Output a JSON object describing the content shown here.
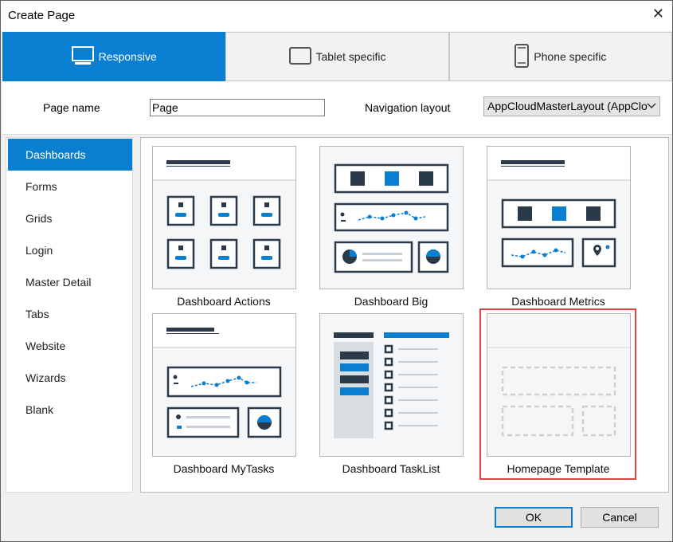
{
  "window": {
    "title": "Create Page",
    "close_glyph": "✕"
  },
  "tabs": [
    {
      "label": "Responsive",
      "icon": "monitor-icon",
      "active": true
    },
    {
      "label": "Tablet specific",
      "icon": "tablet-icon",
      "active": false
    },
    {
      "label": "Phone specific",
      "icon": "phone-icon",
      "active": false
    }
  ],
  "form": {
    "page_name_label": "Page name",
    "page_name_value": "Page",
    "nav_layout_label": "Navigation layout",
    "nav_layout_value": "AppCloudMasterLayout (AppClo"
  },
  "sidebar": {
    "items": [
      {
        "label": "Dashboards",
        "active": true
      },
      {
        "label": "Forms"
      },
      {
        "label": "Grids"
      },
      {
        "label": "Login"
      },
      {
        "label": "Master Detail"
      },
      {
        "label": "Tabs"
      },
      {
        "label": "Website"
      },
      {
        "label": "Wizards"
      },
      {
        "label": "Blank"
      }
    ]
  },
  "templates": [
    {
      "label": "Dashboard Actions"
    },
    {
      "label": "Dashboard Big"
    },
    {
      "label": "Dashboard Metrics"
    },
    {
      "label": "Dashboard MyTasks"
    },
    {
      "label": "Dashboard TaskList"
    },
    {
      "label": "Homepage Template",
      "selected": true
    }
  ],
  "buttons": {
    "ok": "OK",
    "cancel": "Cancel"
  },
  "colors": {
    "accent": "#0a7fd1",
    "dark": "#2b3a4a",
    "selection_outline": "#e04343"
  }
}
